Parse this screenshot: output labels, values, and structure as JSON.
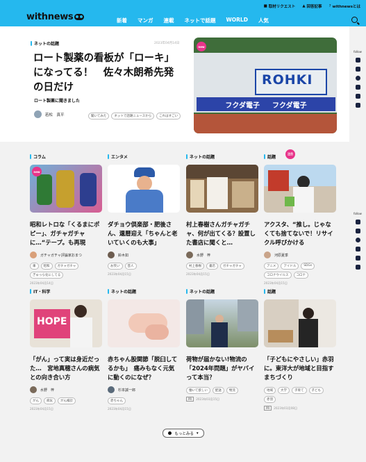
{
  "header": {
    "logo": "withnews",
    "top_links": [
      "取材リクエスト",
      "回答記事",
      "withnewsとは"
    ],
    "nav": [
      "新着",
      "マンガ",
      "連載",
      "ネットで話題",
      "WORLD",
      "人気"
    ]
  },
  "hero": {
    "category": "ネットの話題",
    "date": "2023年04月14日",
    "title": "ロート製薬の看板が「ローキ」になってる！　佐々木朗希先発の日だけ",
    "subtitle": "ロート製薬に聞きました",
    "author": "若松　真平",
    "tags": [
      "聞いてみた",
      "ネットで話題ニュースから",
      "これはすごい"
    ],
    "image_sign": "ROHKI",
    "image_banner": [
      "フクダ電子",
      "フクダ電子"
    ],
    "badge": "new"
  },
  "follow": {
    "label": "follow"
  },
  "cards": [
    {
      "category": "コラム",
      "title": "昭和レトロな「くるまにポピー」、ガチャガチャに…“テープ。も再現",
      "author": "ガチャガチャ評論家おまつ",
      "tags": [
        "車",
        "昭和",
        "ガチャガチャ",
        "ぎゅっら化にしてる"
      ],
      "date": "2023年04月14日",
      "badge": "new"
    },
    {
      "category": "エンタメ",
      "title": "ダチョウ倶楽部・肥後さん、還暦迎え「ちゃんと老いていくのも大事」",
      "author": "鈴木如",
      "tags": [
        "お笑い",
        "芸人"
      ],
      "date": "2023年04月15日"
    },
    {
      "category": "ネットの話題",
      "title": "村上春樹さんガチャガチャ、何が出てくる？設置した書店に聞くと…",
      "author": "水野　梓",
      "tags": [
        "村上春樹",
        "書店",
        "ガチャガチャ"
      ],
      "date": "2023年04月15日"
    },
    {
      "category": "話題",
      "title": "アクスタ、“推し。じゃなくても捨てないで！リサイクル呼びかける",
      "author": "河原夏季",
      "tags": [
        "アニメ",
        "アイドル",
        "SDGs",
        "コロナウイルス",
        "コロナ"
      ],
      "date": "2023年04月15日",
      "badge": "注目"
    },
    {
      "category": "IT・科学",
      "title": "「がん」って実は身近だった…　宮地真穂さんの病気との向き合い方",
      "author": "水野　梓",
      "tags": [
        "がん",
        "病気",
        "がん検診"
      ],
      "date": "2023年04月15日"
    },
    {
      "category": "ネットの話題",
      "title": "赤ちゃん股関節「脱臼してるかも」　痛みもなく元気に動くのになぜ？",
      "author": "杉本誠一郎",
      "tags": [
        "赤ちゃん"
      ],
      "date": "2023年04月15日"
    },
    {
      "category": "ネットの話題",
      "title": "荷物が届かない!物流の「2024年問題」がヤバイって本当？",
      "author": "",
      "tags": [
        "働いて欲しい",
        "配送",
        "物流"
      ],
      "date": "2023年03月15日",
      "pr": "PR"
    },
    {
      "category": "話題",
      "title": "「子どもにやさしい」赤羽に。東洋大が地域と目指すまちづくり",
      "author": "",
      "tags": [
        "地域",
        "大学",
        "子育て",
        "子ども",
        "赤羽"
      ],
      "date": "2023年03月08日",
      "pr": "PR"
    }
  ],
  "more_button": "もっとみる"
}
